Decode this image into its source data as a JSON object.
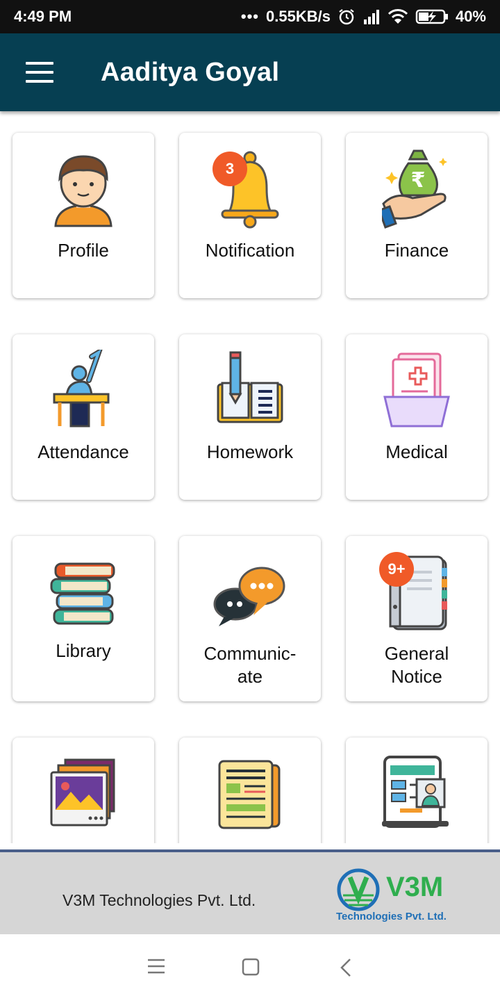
{
  "status_bar": {
    "time": "4:49 PM",
    "network_speed": "0.55KB/s",
    "battery": "40%",
    "icons": [
      "more-dots-icon",
      "alarm-icon",
      "signal-icon",
      "wifi-icon",
      "battery-charging-icon"
    ]
  },
  "app_bar": {
    "title": "Aaditya Goyal",
    "menu_icon": "hamburger-menu-icon"
  },
  "tiles": [
    {
      "label": "Profile",
      "icon": "profile-icon"
    },
    {
      "label": "Notification",
      "icon": "bell-icon",
      "badge": "3"
    },
    {
      "label": "Finance",
      "icon": "money-bag-icon"
    },
    {
      "label": "Attendance",
      "icon": "student-desk-icon"
    },
    {
      "label": "Homework",
      "icon": "book-pencil-icon"
    },
    {
      "label": "Medical",
      "icon": "medical-folder-icon"
    },
    {
      "label": "Library",
      "icon": "books-stack-icon"
    },
    {
      "label_line1": "Communic-",
      "label_line2": "ate",
      "icon": "chat-bubbles-icon"
    },
    {
      "label_line1": "General",
      "label_line2": "Notice",
      "icon": "notice-board-icon",
      "badge": "9+"
    },
    {
      "icon": "gallery-icon"
    },
    {
      "icon": "newspaper-icon"
    },
    {
      "icon": "online-class-icon"
    }
  ],
  "footer": {
    "company": "V3M Technologies Pvt. Ltd.",
    "logo_text": "V3M",
    "logo_subtext": "Technologies Pvt. Ltd."
  },
  "nav_bar": {
    "icons": [
      "recent-apps-icon",
      "home-icon",
      "back-icon"
    ]
  },
  "colors": {
    "app_bar": "#063f52",
    "badge": "#f05a28",
    "footer_bg": "#d6d6d6",
    "logo_green": "#2fae4e",
    "logo_blue": "#1f6fb6"
  }
}
